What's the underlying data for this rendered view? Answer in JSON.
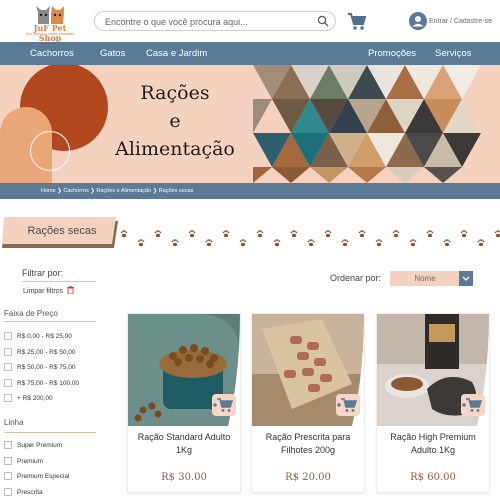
{
  "colors": {
    "brand_blue": "#5a7a96",
    "peach": "#f5d2c0",
    "brown": "#b3481f",
    "tan": "#e8a679",
    "paw": "#8d5a3f"
  },
  "header": {
    "logo_title": "JuF Pet Shop",
    "logo_subtitle": "Seu cachorro, nossa prioridade",
    "search_placeholder": "Encontre o que você procura aqui...",
    "search_icon": "search-icon",
    "cart_icon": "cart-icon",
    "login_label": "Entrar / Cadastre-se",
    "user_icon": "user-circle-icon"
  },
  "nav": {
    "items": [
      "Cachorros",
      "Gatos",
      "Casa e Jardim",
      "Promoções",
      "Serviços"
    ]
  },
  "banner": {
    "line1": "Rações",
    "line2": "e",
    "line3": "Alimentação"
  },
  "breadcrumb": {
    "items": [
      "Home",
      "Cachorros",
      "Rações e Alimentação",
      "Rações secas"
    ]
  },
  "section": {
    "title": "Rações secas"
  },
  "filters": {
    "title": "Filtrar por:",
    "clear": "Limpar filtros",
    "price_title": "Faixa de Preço",
    "price_options": [
      "R$ 0,00 - R$ 25,00",
      "R$ 25,00 - R$ 50,00",
      "R$ 50,00 - R$ 75,00",
      "R$ 75,00 - R$ 100,00",
      "+ R$ 200,00"
    ],
    "line_title": "Linha",
    "line_options": [
      "Super Premium",
      "Premium",
      "Premium Especial",
      "Prescrita"
    ]
  },
  "sort": {
    "label": "Ordenar por:",
    "value": "Nome"
  },
  "products": [
    {
      "name": "Ração Standard Adulto 1Kg",
      "price": "R$ 30.00"
    },
    {
      "name": "Ração Prescrita para Filhotes 200g",
      "price": "R$ 20.00"
    },
    {
      "name": "Ração High Premium Adulto 1Kg",
      "price": "R$ 60.00"
    }
  ]
}
